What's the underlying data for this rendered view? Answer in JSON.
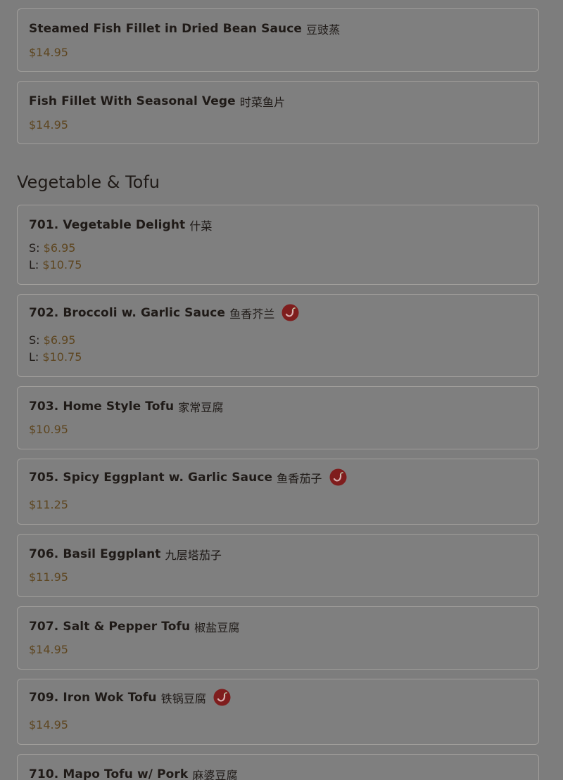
{
  "section_title": "Vegetable & Tofu",
  "items": [
    {
      "name": "Steamed Fish Fillet in Dried Bean Sauce",
      "chinese": "豆豉蒸",
      "price": "$14.95"
    },
    {
      "name": "Fish Fillet With Seasonal Vege",
      "chinese": "时菜鱼片",
      "price": "$14.95"
    },
    {
      "name": "701. Vegetable Delight",
      "chinese": "什菜",
      "small_label": "S:",
      "small_price": "$6.95",
      "large_label": "L:",
      "large_price": "$10.75"
    },
    {
      "name": "702. Broccoli w. Garlic Sauce",
      "chinese": "鱼香芥兰",
      "spicy": true,
      "small_label": "S:",
      "small_price": "$6.95",
      "large_label": "L:",
      "large_price": "$10.75"
    },
    {
      "name": "703. Home Style Tofu",
      "chinese": "家常豆腐",
      "price": "$10.95"
    },
    {
      "name": "705. Spicy Eggplant w. Garlic Sauce",
      "chinese": "鱼香茄子",
      "spicy": true,
      "price": "$11.25"
    },
    {
      "name": "706. Basil Eggplant",
      "chinese": "九层塔茄子",
      "price": "$11.95"
    },
    {
      "name": "707. Salt & Pepper Tofu",
      "chinese": "椒盐豆腐",
      "price": "$14.95"
    },
    {
      "name": "709. Iron Wok Tofu",
      "chinese": "铁锅豆腐",
      "spicy": true,
      "price": "$14.95"
    },
    {
      "name": "710. Mapo Tofu w/ Pork",
      "chinese": "麻婆豆腐"
    }
  ],
  "icons": {
    "spicy": "spicy-chili-icon"
  },
  "colors": {
    "background": "#7d7d7d",
    "card_border": "#a09e9b",
    "price": "#5e4620",
    "spicy_red": "#7f1d1d"
  }
}
